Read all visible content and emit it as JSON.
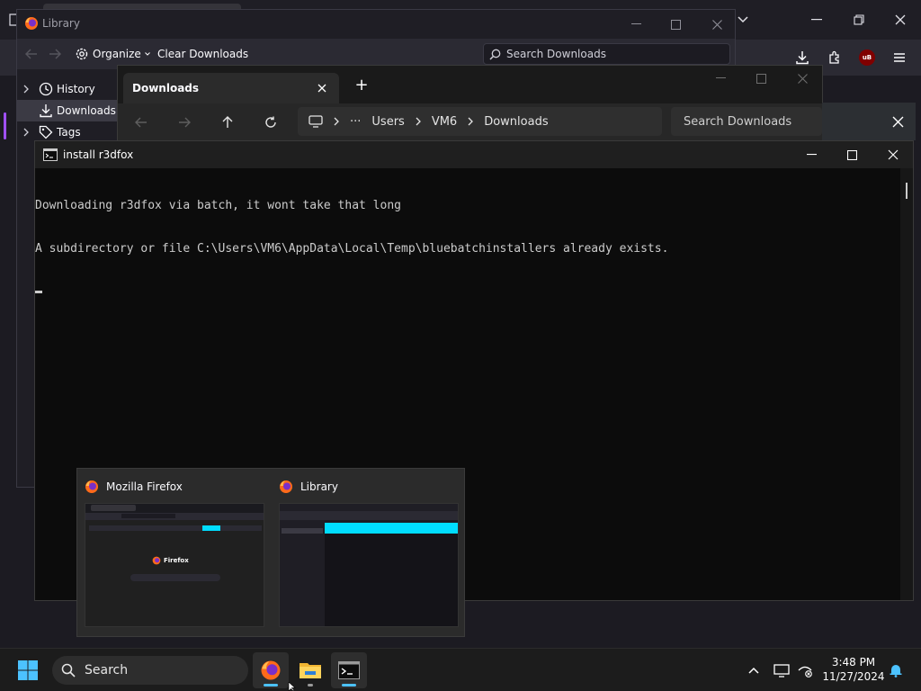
{
  "firefox": {
    "toolbar_icons": [
      "download-icon",
      "extensions-icon",
      "ublock-icon",
      "menu-icon"
    ],
    "ublock_label": "uB"
  },
  "library": {
    "title": "Library",
    "organize_label": "Organize",
    "clear_downloads_label": "Clear Downloads",
    "search_placeholder": "Search Downloads",
    "sidebar": [
      {
        "label": "History",
        "icon": "clock-icon"
      },
      {
        "label": "Downloads",
        "icon": "download-icon",
        "selected": true
      },
      {
        "label": "Tags",
        "icon": "tag-icon"
      }
    ]
  },
  "explorer": {
    "tab_title": "Downloads",
    "new_tab": "+",
    "breadcrumb": [
      "Users",
      "VM6",
      "Downloads"
    ],
    "ellipsis": "···",
    "search_placeholder": "Search Downloads"
  },
  "cmd": {
    "title": "install r3dfox",
    "lines": [
      "Downloading r3dfox via batch, it wont take that long",
      "A subdirectory or file C:\\Users\\VM6\\AppData\\Local\\Temp\\bluebatchinstallers already exists."
    ]
  },
  "previews": [
    {
      "title": "Mozilla Firefox",
      "inner_label": "Firefox"
    },
    {
      "title": "Library"
    }
  ],
  "taskbar": {
    "search_label": "Search",
    "time": "3:48 PM",
    "date": "11/27/2024"
  },
  "colors": {
    "accent": "#4cc2ff",
    "library_highlight": "#00ddff",
    "ublock": "#800000"
  }
}
